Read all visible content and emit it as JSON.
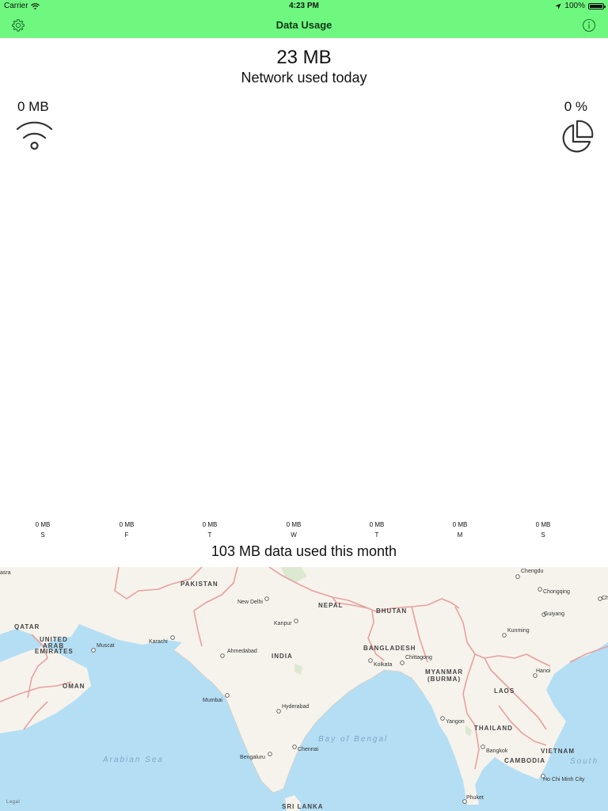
{
  "status_bar": {
    "carrier": "Carrier",
    "time": "4:23 PM",
    "battery": "100%"
  },
  "nav": {
    "title": "Data Usage",
    "left_icon": "gear-icon",
    "right_icon": "info-icon"
  },
  "today": {
    "value": "23 MB",
    "label": "Network used today"
  },
  "wifi": {
    "value": "0 MB",
    "icon": "wifi-icon"
  },
  "share": {
    "value": "0 %",
    "icon": "pie-chart-icon"
  },
  "week": [
    {
      "amount": "0 MB",
      "day": "S"
    },
    {
      "amount": "0 MB",
      "day": "F"
    },
    {
      "amount": "0 MB",
      "day": "T"
    },
    {
      "amount": "0 MB",
      "day": "W"
    },
    {
      "amount": "0 MB",
      "day": "T"
    },
    {
      "amount": "0 MB",
      "day": "M"
    },
    {
      "amount": "0 MB",
      "day": "S"
    }
  ],
  "month": {
    "label": "103 MB data used this month"
  },
  "map": {
    "countries": [
      "PAKISTAN",
      "NEPAL",
      "BHUTAN",
      "INDIA",
      "BANGLADESH",
      "MYANMAR",
      "(BURMA)",
      "LAOS",
      "THAILAND",
      "VIETNAM",
      "CAMBODIA",
      "SRI LANKA",
      "QATAR",
      "UNITED",
      "ARAB",
      "EMIRATES",
      "OMAN"
    ],
    "seas": [
      "Arabian Sea",
      "Bay of Bengal",
      "South"
    ],
    "cities": [
      "Chengdu",
      "Chongqing",
      "Guiyang",
      "Kunming",
      "New Delhi",
      "Kanpur",
      "Karachi",
      "Muscat",
      "Ahmedabad",
      "Chittagong",
      "Kolkata",
      "Hanoi",
      "Mumbai",
      "Hyderabad",
      "Yangon",
      "Bangkok",
      "Chennai",
      "Bengaluru",
      "Ho Chi Minh City",
      "Phuket"
    ],
    "edge_labels": [
      "asra",
      "Ch",
      "Legal"
    ],
    "colors": {
      "water": "#b4def4",
      "land": "#f6f3ec",
      "border": "#e7a0a0"
    }
  },
  "colors": {
    "accent": "#6ff87f"
  }
}
